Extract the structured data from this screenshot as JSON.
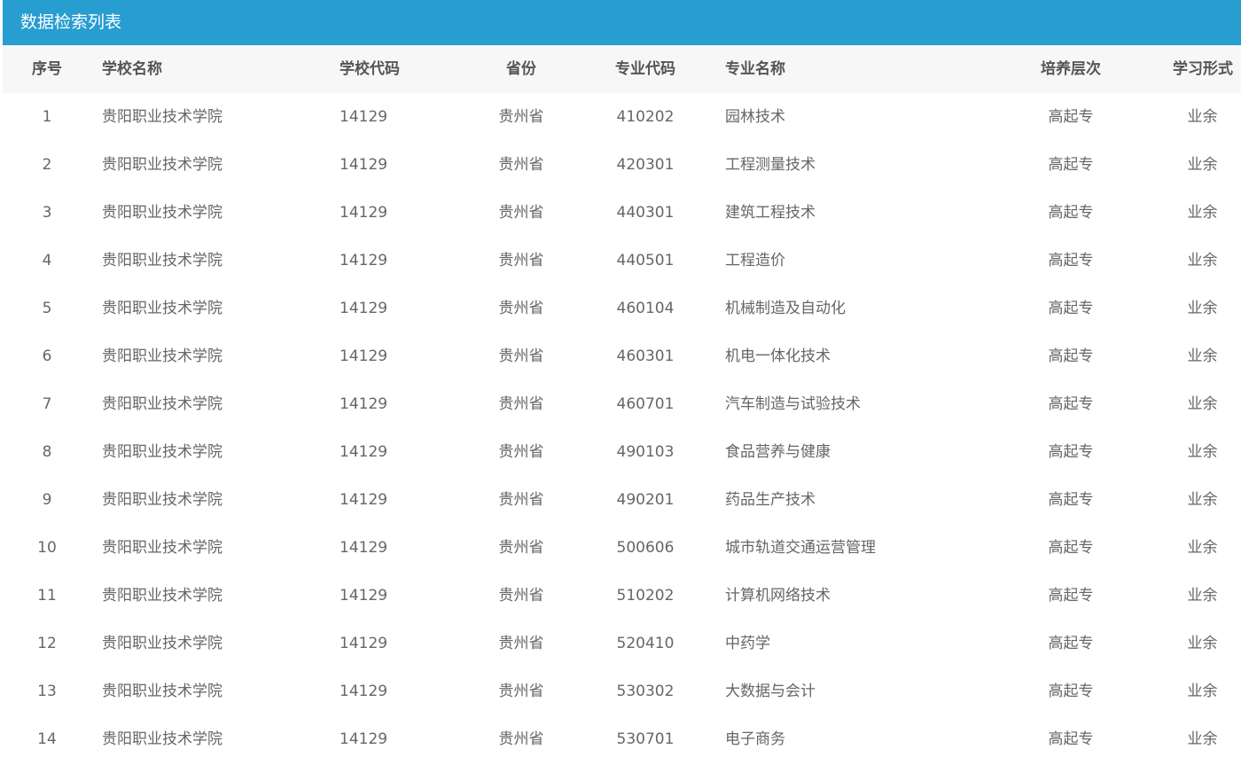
{
  "title": "数据检索列表",
  "headers": {
    "seq": "序号",
    "school_name": "学校名称",
    "school_code": "学校代码",
    "province": "省份",
    "major_code": "专业代码",
    "major_name": "专业名称",
    "level": "培养层次",
    "study_form": "学习形式"
  },
  "rows": [
    {
      "seq": "1",
      "school_name": "贵阳职业技术学院",
      "school_code": "14129",
      "province": "贵州省",
      "major_code": "410202",
      "major_name": "园林技术",
      "level": "高起专",
      "study_form": "业余"
    },
    {
      "seq": "2",
      "school_name": "贵阳职业技术学院",
      "school_code": "14129",
      "province": "贵州省",
      "major_code": "420301",
      "major_name": "工程测量技术",
      "level": "高起专",
      "study_form": "业余"
    },
    {
      "seq": "3",
      "school_name": "贵阳职业技术学院",
      "school_code": "14129",
      "province": "贵州省",
      "major_code": "440301",
      "major_name": "建筑工程技术",
      "level": "高起专",
      "study_form": "业余"
    },
    {
      "seq": "4",
      "school_name": "贵阳职业技术学院",
      "school_code": "14129",
      "province": "贵州省",
      "major_code": "440501",
      "major_name": "工程造价",
      "level": "高起专",
      "study_form": "业余"
    },
    {
      "seq": "5",
      "school_name": "贵阳职业技术学院",
      "school_code": "14129",
      "province": "贵州省",
      "major_code": "460104",
      "major_name": "机械制造及自动化",
      "level": "高起专",
      "study_form": "业余"
    },
    {
      "seq": "6",
      "school_name": "贵阳职业技术学院",
      "school_code": "14129",
      "province": "贵州省",
      "major_code": "460301",
      "major_name": "机电一体化技术",
      "level": "高起专",
      "study_form": "业余"
    },
    {
      "seq": "7",
      "school_name": "贵阳职业技术学院",
      "school_code": "14129",
      "province": "贵州省",
      "major_code": "460701",
      "major_name": "汽车制造与试验技术",
      "level": "高起专",
      "study_form": "业余"
    },
    {
      "seq": "8",
      "school_name": "贵阳职业技术学院",
      "school_code": "14129",
      "province": "贵州省",
      "major_code": "490103",
      "major_name": "食品营养与健康",
      "level": "高起专",
      "study_form": "业余"
    },
    {
      "seq": "9",
      "school_name": "贵阳职业技术学院",
      "school_code": "14129",
      "province": "贵州省",
      "major_code": "490201",
      "major_name": "药品生产技术",
      "level": "高起专",
      "study_form": "业余"
    },
    {
      "seq": "10",
      "school_name": "贵阳职业技术学院",
      "school_code": "14129",
      "province": "贵州省",
      "major_code": "500606",
      "major_name": "城市轨道交通运营管理",
      "level": "高起专",
      "study_form": "业余"
    },
    {
      "seq": "11",
      "school_name": "贵阳职业技术学院",
      "school_code": "14129",
      "province": "贵州省",
      "major_code": "510202",
      "major_name": "计算机网络技术",
      "level": "高起专",
      "study_form": "业余"
    },
    {
      "seq": "12",
      "school_name": "贵阳职业技术学院",
      "school_code": "14129",
      "province": "贵州省",
      "major_code": "520410",
      "major_name": "中药学",
      "level": "高起专",
      "study_form": "业余"
    },
    {
      "seq": "13",
      "school_name": "贵阳职业技术学院",
      "school_code": "14129",
      "province": "贵州省",
      "major_code": "530302",
      "major_name": "大数据与会计",
      "level": "高起专",
      "study_form": "业余"
    },
    {
      "seq": "14",
      "school_name": "贵阳职业技术学院",
      "school_code": "14129",
      "province": "贵州省",
      "major_code": "530701",
      "major_name": "电子商务",
      "level": "高起专",
      "study_form": "业余"
    }
  ],
  "colors": {
    "title_bar": "#279dd0",
    "header_bg": "#f7f7f7",
    "header_text": "#555555",
    "cell_text": "#666666"
  }
}
